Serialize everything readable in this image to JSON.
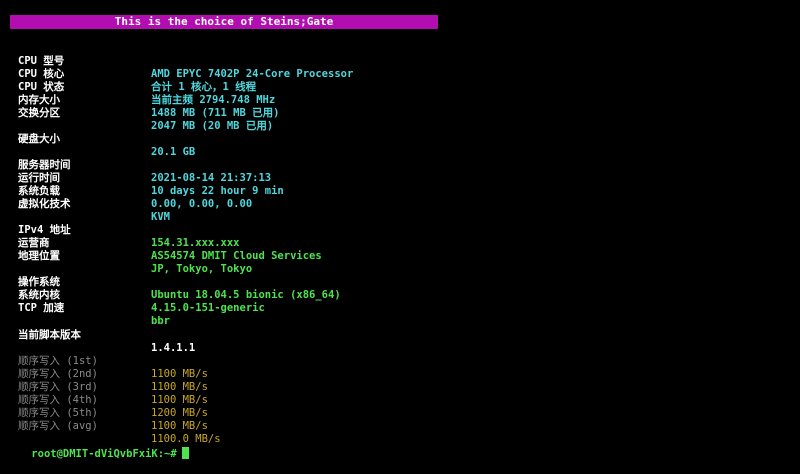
{
  "banner": "This is the choice of Steins;Gate",
  "system": [
    {
      "label": "CPU 型号",
      "value": "AMD EPYC 7402P 24-Core Processor"
    },
    {
      "label": "CPU 核心",
      "value": "合计 1 核心，1 线程"
    },
    {
      "label": "CPU 状态",
      "value": "当前主频 2794.748 MHz"
    },
    {
      "label": "内存大小",
      "value": "1488 MB (711 MB 已用)"
    },
    {
      "label": "交换分区",
      "value": "2047 MB (20 MB 已用)"
    }
  ],
  "disk": {
    "label": "硬盘大小",
    "value": "20.1 GB"
  },
  "runtime": [
    {
      "label": "服务器时间",
      "value": "2021-08-14 21:37:13"
    },
    {
      "label": "运行时间",
      "value": "10 days 22 hour 9 min"
    },
    {
      "label": "系统负载",
      "value": "0.00, 0.00, 0.00"
    },
    {
      "label": "虚拟化技术",
      "value": "KVM"
    }
  ],
  "network": [
    {
      "label": "IPv4 地址",
      "value": "154.31.xxx.xxx"
    },
    {
      "label": "运营商",
      "value": "AS54574 DMIT Cloud Services"
    },
    {
      "label": "地理位置",
      "value": "JP, Tokyo, Tokyo"
    }
  ],
  "os": [
    {
      "label": "操作系统",
      "value": "Ubuntu 18.04.5 bionic (x86_64)"
    },
    {
      "label": "系统内核",
      "value": "4.15.0-151-generic"
    },
    {
      "label": "TCP 加速",
      "value": "bbr"
    }
  ],
  "script_version": {
    "label": "当前脚本版本",
    "value": "1.4.1.1"
  },
  "io_tests": [
    {
      "label": "顺序写入 (1st)",
      "value": "1100 MB/s"
    },
    {
      "label": "顺序写入 (2nd)",
      "value": "1100 MB/s"
    },
    {
      "label": "顺序写入 (3rd)",
      "value": "1100 MB/s"
    },
    {
      "label": "顺序写入 (4th)",
      "value": "1200 MB/s"
    },
    {
      "label": "顺序写入 (5th)",
      "value": "1100 MB/s"
    },
    {
      "label": "顺序写入 (avg)",
      "value": "1100.0 MB/s"
    }
  ],
  "prompt": "root@DMIT-dViQvbFxiK:~#",
  "colors": {
    "banner_bg": "#b10db1",
    "cyan": "#4fd7dd",
    "green": "#4ee34e",
    "yellow": "#c9a825",
    "dim_gray": "#8a8a8a"
  }
}
